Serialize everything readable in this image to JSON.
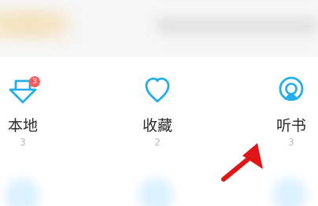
{
  "colors": {
    "accent": "#23aee9",
    "badge": "#ff5c5c",
    "arrow": "#e01616"
  },
  "menu": {
    "items": [
      {
        "label": "本地",
        "count": "3",
        "icon": "download-arrow-icon",
        "badge": "3"
      },
      {
        "label": "收藏",
        "count": "2",
        "icon": "heart-icon"
      },
      {
        "label": "听书",
        "count": "3",
        "icon": "headphones-icon"
      }
    ]
  }
}
